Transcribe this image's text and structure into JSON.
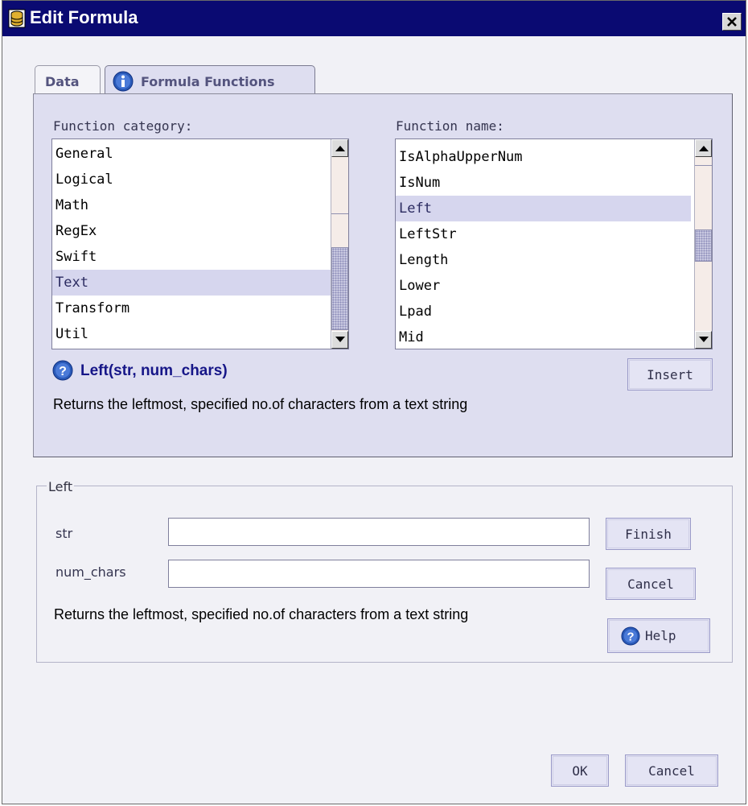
{
  "window": {
    "title": "Edit Formula",
    "close_symbol": "×"
  },
  "tabs": [
    {
      "label": "Data",
      "active": false
    },
    {
      "label": "Formula Functions",
      "active": true,
      "icon": "info-icon"
    }
  ],
  "category_list": {
    "label": "Function category:",
    "items": [
      "General",
      "Logical",
      "Math",
      "RegEx",
      "Swift",
      "Text",
      "Transform",
      "Util"
    ],
    "selected": "Text"
  },
  "function_list": {
    "label": "Function name:",
    "items": [
      "IsAlphaUpperNum",
      "IsNum",
      "Left",
      "LeftStr",
      "Length",
      "Lower",
      "Lpad",
      "Mid"
    ],
    "selected": "Left"
  },
  "function_info": {
    "signature": "Left(str, num_chars)",
    "description": "Returns the leftmost, specified no.of characters from a text string",
    "icon": "help-icon"
  },
  "insert_label": "Insert",
  "params_group": {
    "legend": "Left",
    "params": [
      {
        "label": "str",
        "value": ""
      },
      {
        "label": "num_chars",
        "value": ""
      }
    ],
    "description": "Returns the leftmost, specified no.of characters from a text string",
    "finish_label": "Finish",
    "cancel_label": "Cancel",
    "help_label": "Help"
  },
  "footer": {
    "ok_label": "OK",
    "cancel_label": "Cancel"
  },
  "colors": {
    "titlebar": "#0a0a72",
    "selection": "#d6d6ee",
    "panel": "#dedef0"
  }
}
